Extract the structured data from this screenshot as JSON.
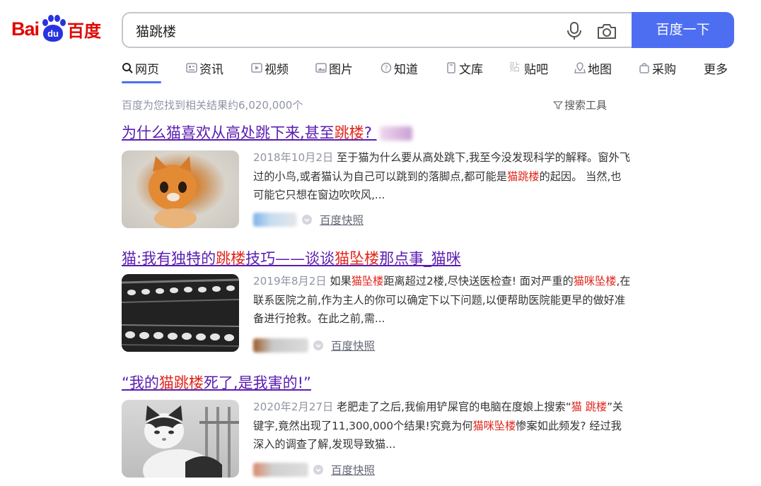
{
  "logo": {
    "prefix": "Bai",
    "paw_text": "du",
    "suffix": "百度"
  },
  "search": {
    "query": "猫跳楼",
    "button_label": "百度一下"
  },
  "tabs": [
    {
      "label": "网页",
      "icon": "search-icon",
      "active": true
    },
    {
      "label": "资讯",
      "icon": "news-icon"
    },
    {
      "label": "视频",
      "icon": "video-icon"
    },
    {
      "label": "图片",
      "icon": "image-icon"
    },
    {
      "label": "知道",
      "icon": "question-icon"
    },
    {
      "label": "文库",
      "icon": "document-icon"
    },
    {
      "label": "贴吧",
      "icon": "tieba-icon"
    },
    {
      "label": "地图",
      "icon": "map-icon"
    },
    {
      "label": "采购",
      "icon": "shopping-icon"
    },
    {
      "label": "更多"
    }
  ],
  "results_count": "百度为您找到相关结果约6,020,000个",
  "search_tools_label": "搜索工具",
  "results": [
    {
      "title": [
        "为什么猫喜欢从高处跳下来,甚至",
        "跳楼",
        "?"
      ],
      "date": "2018年10月2日",
      "abstract": [
        [
          "至于猫为什么要从高处跳下,我至今没发现科学的解释。",
          false
        ],
        [
          "窗外飞过的小鸟,或者猫认为自己可以跳到的落脚点,都可能是",
          false
        ],
        [
          "猫跳楼",
          true
        ],
        [
          "的起因。 当然,也可能它只想在窗边吹吹风,...",
          false
        ]
      ],
      "snapshot": "百度快照",
      "thumb": "kitten-photo"
    },
    {
      "title": [
        "猫:我有独特的",
        "跳楼",
        "技巧——谈谈",
        "猫坠楼",
        "那点事_猫咪"
      ],
      "date": "2019年8月2日",
      "abstract": [
        [
          "如果",
          false
        ],
        [
          "猫坠楼",
          true
        ],
        [
          "距离超过2楼,尽快送医检查! 面对严重的",
          false
        ],
        [
          "猫咪坠楼",
          true
        ],
        [
          ",在联系医院之前,作为主人的你可以确定下以下问题,以便帮助医院能更早的做好准备进行抢救。在此之前,需...",
          false
        ]
      ],
      "snapshot": "百度快照",
      "thumb": "falling-cat-sequence-photo"
    },
    {
      "title": [
        "“我的",
        "猫跳楼",
        "死了,是我害的!”"
      ],
      "date": "2020年2月27日",
      "abstract": [
        [
          "老肥走了之后,我偷用铲屎官的电脑在度娘上搜索“",
          false
        ],
        [
          "猫 跳楼",
          true
        ],
        [
          "”关键字,竟然出现了11,300,000个结果!究竟为何",
          false
        ],
        [
          "猫咪坠楼",
          true
        ],
        [
          "惨案如此频发? 经过我深入的调查了解,发现导致猫...",
          false
        ]
      ],
      "snapshot": "百度快照",
      "thumb": "grumpy-cat-photo"
    }
  ],
  "colors": {
    "brand_blue": "#4e6ef2",
    "logo_red": "#e10601",
    "highlight_red": "#e0261c",
    "visited_purple": "#5a1cb0",
    "meta_gray": "#9195a3"
  }
}
